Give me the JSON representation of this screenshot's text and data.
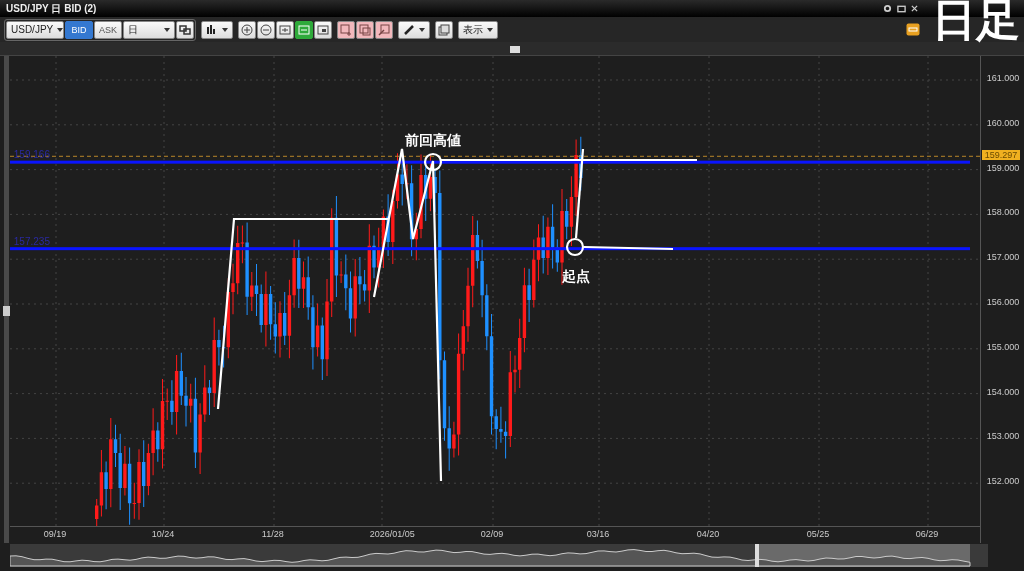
{
  "window": {
    "title": "USD/JPY 日 BID (2)"
  },
  "caption": "日足",
  "toolbar": {
    "symbol": "USD/JPY",
    "price_sides": [
      {
        "label": "BID",
        "selected": true
      },
      {
        "label": "ASK",
        "selected": false
      }
    ],
    "period": "日",
    "tool_buttons": [
      {
        "kind": "zoom-in",
        "selected": false
      },
      {
        "kind": "zoom-out",
        "selected": false
      },
      {
        "kind": "fit",
        "selected": false
      },
      {
        "kind": "expand",
        "selected": true
      },
      {
        "kind": "panel",
        "selected": false
      }
    ],
    "display_menu": "表示"
  },
  "chart": {
    "price_axis": [
      "161.000",
      "160.000",
      "159.000",
      "158.000",
      "157.000",
      "156.000",
      "155.000",
      "154.000",
      "153.000",
      "152.000"
    ],
    "current_price": "159.297",
    "level_lines": [
      {
        "label": "159.166"
      },
      {
        "label": "157.235"
      }
    ],
    "date_axis": [
      "09/19",
      "10/24",
      "11/28",
      "2026/01/05",
      "02/09",
      "03/16",
      "04/20",
      "05/25",
      "06/29"
    ],
    "annotations": [
      {
        "text": "前回高値"
      },
      {
        "text": "起点"
      }
    ]
  }
}
